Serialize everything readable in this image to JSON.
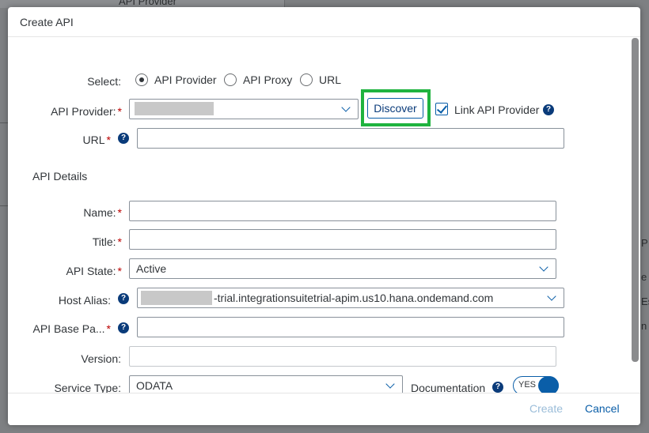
{
  "background": {
    "snippet_top": "API Provider",
    "snippet_right_1": "P",
    "snippet_right_2": "e",
    "snippet_right_3": "Es",
    "snippet_right_4": "n"
  },
  "dialog": {
    "title": "Create API",
    "select": {
      "label": "Select:",
      "options": [
        "API Provider",
        "API Proxy",
        "URL"
      ],
      "selected": "API Provider"
    },
    "api_provider": {
      "label": "API Provider:",
      "value": ""
    },
    "discover_label": "Discover",
    "link_api_provider": {
      "label": "Link API Provider",
      "checked": true
    },
    "url": {
      "label": "URL",
      "value": ""
    },
    "section_api_details": "API Details",
    "name": {
      "label": "Name:",
      "value": ""
    },
    "title_field": {
      "label": "Title:",
      "value": ""
    },
    "api_state": {
      "label": "API State:",
      "value": "Active"
    },
    "host_alias": {
      "label": "Host Alias:",
      "value": "-trial.integrationsuitetrial-apim.us10.hana.ondemand.com"
    },
    "api_base_path": {
      "label": "API Base Pa...",
      "value": ""
    },
    "version": {
      "label": "Version:",
      "value": ""
    },
    "service_type": {
      "label": "Service Type:",
      "value": "ODATA"
    },
    "documentation": {
      "label": "Documentation",
      "toggle_label": "YES",
      "on": true
    },
    "footer": {
      "create_label": "Create",
      "cancel_label": "Cancel"
    },
    "help_glyph": "?"
  },
  "colors": {
    "accent": "#0a5ea8",
    "required": "#bb0000",
    "highlight": "#1fb33f"
  }
}
